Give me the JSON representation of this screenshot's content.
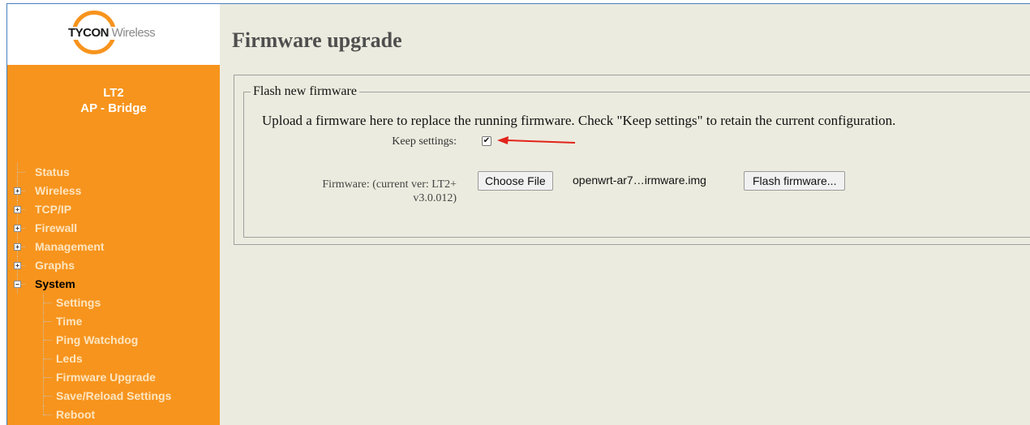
{
  "logo": {
    "brand": "TYCON",
    "sub": "Wireless"
  },
  "device": {
    "model": "LT2",
    "mode": "AP - Bridge"
  },
  "nav": {
    "items": [
      {
        "label": "Status",
        "expander": ""
      },
      {
        "label": "Wireless",
        "expander": "+"
      },
      {
        "label": "TCP/IP",
        "expander": "+"
      },
      {
        "label": "Firewall",
        "expander": "+"
      },
      {
        "label": "Management",
        "expander": "+"
      },
      {
        "label": "Graphs",
        "expander": "+"
      },
      {
        "label": "System",
        "expander": "−"
      }
    ],
    "system_sub": [
      "Settings",
      "Time",
      "Ping Watchdog",
      "Leds",
      "Firmware Upgrade",
      "Save/Reload Settings",
      "Reboot"
    ]
  },
  "main": {
    "title": "Firmware upgrade",
    "legend": "Flash new firmware",
    "description": "Upload a firmware here to replace the running firmware. Check \"Keep settings\" to retain the current configuration.",
    "keep_settings_label": "Keep settings:",
    "keep_settings_checked": true,
    "firmware_label_line1": "Firmware: (current ver: LT2+",
    "firmware_label_line2": "v3.0.012)",
    "choose_file_label": "Choose File",
    "file_name": "openwrt-ar7…irmware.img",
    "flash_button_label": "Flash firmware..."
  },
  "colors": {
    "sidebar": "#f7941d",
    "content_bg": "#ecebdf",
    "arrow": "#e2231a"
  }
}
